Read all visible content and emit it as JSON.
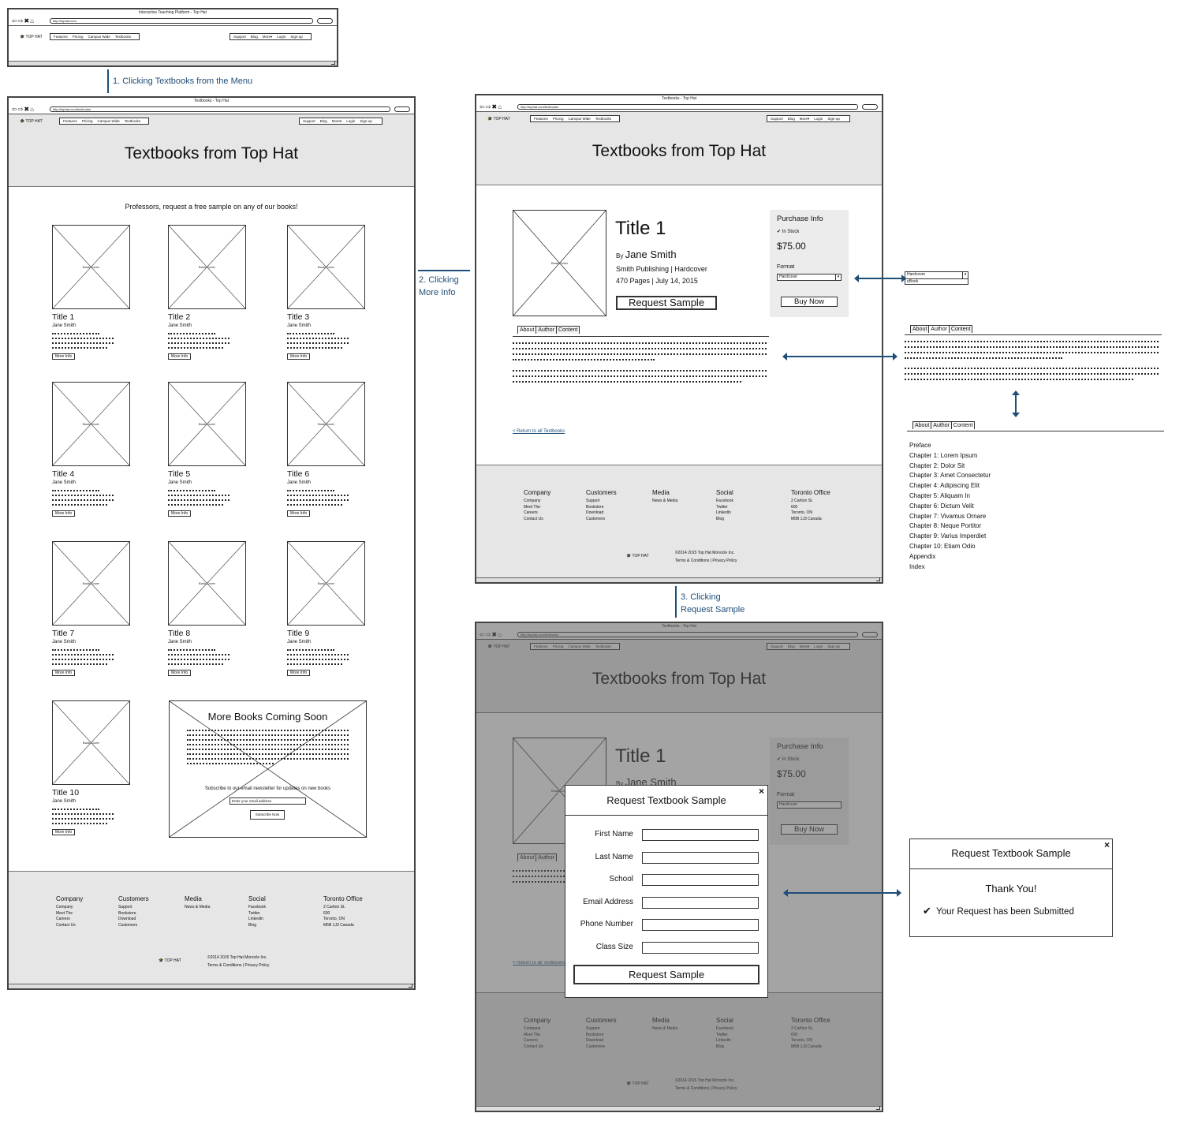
{
  "browser": {
    "title_home": "Interactive Teaching Platform - Top Hat",
    "title_textbooks": "Textbooks - Top Hat",
    "url_home": "http://tophat.com",
    "url_textbooks": "http://tophat.com/textbooks",
    "nav_glyphs": "⇦⇨✖⌂"
  },
  "nav": {
    "logo": "TOP HAT",
    "left": [
      "Features",
      "Pricing",
      "Campus Wide",
      "Textbooks"
    ],
    "right": [
      "Support",
      "Blog",
      "More▾",
      "Login",
      "Sign-up"
    ]
  },
  "annotations": {
    "step1": "1. Clicking Textbooks from the Menu",
    "step2_line1": "2. Clicking",
    "step2_line2": "More Info",
    "step3_line1": "3. Clicking",
    "step3_line2": "Request Sample"
  },
  "catalog": {
    "hero_title": "Textbooks from Top Hat",
    "intro": "Professors, request a free sample on any of our books!",
    "cover_label": "Book Cover",
    "more_info_label": "More Info",
    "books": [
      {
        "title": "Title 1",
        "author": "Jane Smith"
      },
      {
        "title": "Title 2",
        "author": "Jane Smith"
      },
      {
        "title": "Title 3",
        "author": "Jane Smith"
      },
      {
        "title": "Title 4",
        "author": "Jane Smith"
      },
      {
        "title": "Title 5",
        "author": "Jane Smith"
      },
      {
        "title": "Title 6",
        "author": "Jane Smith"
      },
      {
        "title": "Title 7",
        "author": "Jane Smith"
      },
      {
        "title": "Title 8",
        "author": "Jane Smith"
      },
      {
        "title": "Title 9",
        "author": "Jane Smith"
      },
      {
        "title": "Title 10",
        "author": "Jane Smith"
      }
    ],
    "coming_soon": {
      "title": "More Books Coming Soon",
      "subscribe_text": "Subscribe to our email newsletter for updates on new books",
      "email_placeholder": "Enter your email address",
      "button": "Subscribe Now"
    }
  },
  "detail": {
    "title": "Title 1",
    "by": "By",
    "author": "Jane Smith",
    "publisher": "Smith Publishing | Hardcover",
    "pages_date": "470 Pages | July 14, 2015",
    "request_button": "Request Sample",
    "purchase": {
      "heading": "Purchase Info",
      "stock": "In Stock",
      "price": "$75.00",
      "format_label": "Format",
      "format_value": "Hardcover",
      "buy_button": "Buy Now"
    },
    "tabs": [
      "About",
      "Author",
      "Content"
    ],
    "return_link": "< Return to all Textbooks",
    "format_options": [
      "Hardcover",
      "eBook"
    ],
    "contents": [
      "Preface",
      "Chapter 1: Lorem Ipsum",
      "Chapter 2: Dolor Sit",
      "Chapter 3: Amet Consectetur",
      "Chapter 4: Adipiscing Elit",
      "Chapter 5: Aliquam In",
      "Chapter 6: Dictum Velit",
      "Chapter 7: Vivamus Ornare",
      "Chapter 8: Neque Portitor",
      "Chapter 9: Varius Imperdiet",
      "Chapter 10: Etiam Odio",
      "Appendix",
      "Index"
    ]
  },
  "footer": {
    "columns": [
      {
        "heading": "Company",
        "items": [
          "Company",
          "Meet The",
          "Careers",
          "Contact Us"
        ]
      },
      {
        "heading": "Customers",
        "items": [
          "Support",
          "Bookstore",
          "Download",
          "Customers"
        ]
      },
      {
        "heading": "Media",
        "items": [
          "News & Media"
        ]
      },
      {
        "heading": "Social",
        "items": [
          "Facebook",
          "Twitter",
          "LinkedIn",
          "Blog"
        ]
      },
      {
        "heading": "Toronto Office",
        "items": [
          "2 Carlton St.",
          "600",
          "Toronto, ON",
          "M5B 1J3 Canada"
        ]
      }
    ],
    "logo": "TOP HAT",
    "copyright": "©2014 2015 Top Hat Monocle Inc.",
    "links": "Terms & Conditions | Privacy Policy"
  },
  "modal": {
    "title": "Request Textbook Sample",
    "close": "×",
    "fields": [
      "First Name",
      "Last Name",
      "School",
      "Email Address",
      "Phone Number",
      "Class Size"
    ],
    "submit": "Request Sample"
  },
  "confirm": {
    "title": "Request Textbook Sample",
    "close": "×",
    "thanks": "Thank You!",
    "message": "Your Request has been Submitted"
  },
  "colors": {
    "annotation": "#1f4e79",
    "hero_bg": "#e6e6e6",
    "overlay": "#8c8c8c"
  }
}
